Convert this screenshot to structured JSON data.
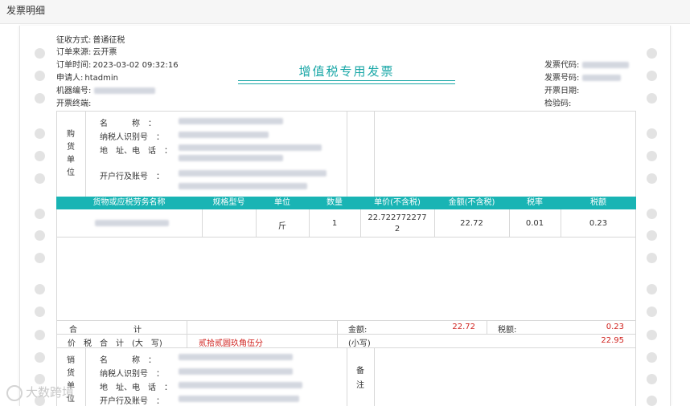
{
  "window": {
    "title": "发票明细"
  },
  "order_info": {
    "collection_label": "征收方式:",
    "collection_value": "普通征税",
    "source_label": "订单来源:",
    "source_value": "云开票",
    "time_label": "订单时间:",
    "time_value": "2023-03-02 09:32:16",
    "applicant_label": "申请人:",
    "applicant_value": "htadmin",
    "machine_label": "机器编号:",
    "terminal_label": "开票终端:"
  },
  "invoice_title": "增值税专用发票",
  "invoice_meta": {
    "code_label": "发票代码:",
    "number_label": "发票号码:",
    "date_label": "开票日期:",
    "check_label": "检验码:"
  },
  "buyer": {
    "side_label": [
      "购",
      "货",
      "单",
      "位"
    ],
    "name_label": "名　　　称　：",
    "tax_id_label": "纳税人识别号　：",
    "address_label": "地　址、电　话　：",
    "bank_label": "开户行及账号　："
  },
  "table": {
    "headers": [
      "货物或应税劳务名称",
      "规格型号",
      "单位",
      "数量",
      "单价(不含税)",
      "金额(不含税)",
      "税率",
      "税额"
    ],
    "rows": [
      {
        "unit": "斤",
        "qty": "1",
        "price_line1": "22.722772277",
        "price_line2": "2",
        "amount": "22.72",
        "rate": "0.01",
        "tax": "0.23"
      }
    ]
  },
  "totals": {
    "sum_label": "合　　　　　　　计",
    "amount_label": "金额:",
    "amount_value": "22.72",
    "tax_label": "税额:",
    "tax_value": "0.23",
    "grand_label": "价　税　合　计　(大　写)",
    "grand_words": "贰拾贰圆玖角伍分",
    "small_label": "(小写)",
    "small_value": "22.95"
  },
  "seller": {
    "side_label": [
      "销",
      "货",
      "单",
      "位"
    ],
    "name_label": "名　　　称　：",
    "tax_id_label": "纳税人识别号　：",
    "address_label": "地　址、电　话　：",
    "bank_label": "开户行及账号　：",
    "remark_label": [
      "备",
      "注"
    ]
  },
  "watermark": "大数跨境",
  "colors": {
    "accent": "#19b4b4",
    "red": "#d0231f",
    "hole": "#e3e3e3"
  }
}
